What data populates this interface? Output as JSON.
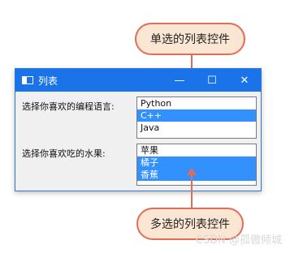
{
  "callouts": {
    "top": "单选的列表控件",
    "bottom": "多选的列表控件"
  },
  "window": {
    "title": "列表",
    "minimize_glyph": "—",
    "maximize_glyph": "☐",
    "close_glyph": "✕"
  },
  "form": {
    "lang_label": "选择你喜欢的编程语言:",
    "fruit_label": "选择你喜欢吃的水果:"
  },
  "lists": {
    "languages": {
      "items": [
        {
          "label": "Python",
          "selected": false
        },
        {
          "label": "C++",
          "selected": true
        },
        {
          "label": "Java",
          "selected": false
        }
      ]
    },
    "fruits": {
      "items": [
        {
          "label": "苹果",
          "selected": false
        },
        {
          "label": "橘子",
          "selected": true
        },
        {
          "label": "香蕉",
          "selected": true
        }
      ]
    }
  },
  "watermark": "CSDN @孤傲倾城",
  "colors": {
    "accent": "#1a73e8",
    "selection": "#3390ff",
    "callout_border": "#e06d58",
    "callout_fill": "#fbe6d3"
  }
}
